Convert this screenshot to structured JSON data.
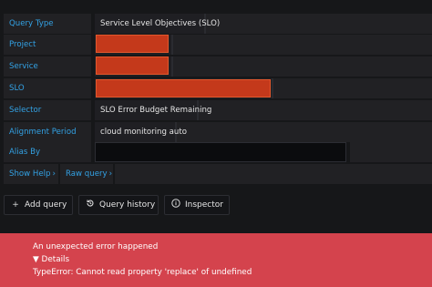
{
  "query_editor": {
    "query_type": {
      "label": "Query Type",
      "value": "Service Level Objectives (SLO)"
    },
    "project": {
      "label": "Project"
    },
    "service": {
      "label": "Service"
    },
    "slo": {
      "label": "SLO"
    },
    "selector": {
      "label": "Selector",
      "value": "SLO Error Budget Remaining"
    },
    "alignment_period": {
      "label": "Alignment Period",
      "value": "cloud monitoring auto"
    },
    "alias_by": {
      "label": "Alias By",
      "value": ""
    },
    "show_help": "Show Help",
    "raw_query": "Raw query",
    "chevron": "›"
  },
  "actions": {
    "add_query": "Add query",
    "query_history": "Query history",
    "inspector": "Inspector"
  },
  "error": {
    "title": "An unexpected error happened",
    "details_toggle": "▼ Details",
    "message": "TypeError: Cannot read property 'replace' of undefined"
  },
  "colors": {
    "label_text": "#33a2e5",
    "redacted_fill": "#c4391b",
    "error_background": "#d4434d"
  }
}
